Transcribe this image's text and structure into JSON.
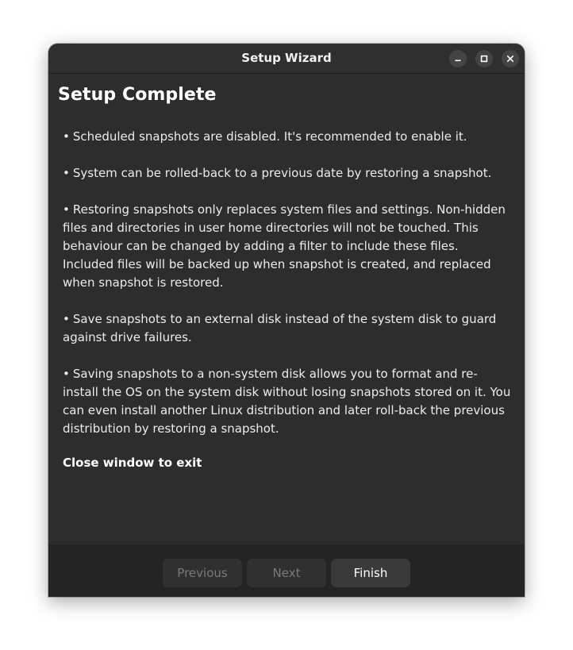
{
  "window": {
    "title": "Setup Wizard"
  },
  "page": {
    "heading": "Setup Complete",
    "bullet_glyph": "•",
    "notes": [
      "Scheduled snapshots are disabled. It's recommended to enable it.",
      "System can be rolled-back to a previous date by restoring a snapshot.",
      "Restoring snapshots only replaces system files and settings. Non-hidden files and directories in user home directories will not be touched. This behaviour can be changed by adding a filter to include these files. Included files will be backed up when snapshot is created, and replaced when snapshot is restored.",
      "Save snapshots to an external disk instead of the system disk to guard against drive failures.",
      "Saving snapshots to a non-system disk allows you to format and re-install the OS on the system disk without losing snapshots stored on it. You can even install another Linux distribution and later roll-back the previous distribution by restoring a snapshot."
    ],
    "exit_text": "Close window to exit"
  },
  "footer": {
    "previous_label": "Previous",
    "next_label": "Next",
    "finish_label": "Finish"
  },
  "icons": {
    "minimize": "minimize-icon",
    "maximize": "maximize-icon",
    "close": "close-icon"
  },
  "colors": {
    "window_bg": "#2d2d2d",
    "footer_bg": "#242424",
    "button_bg": "#303030",
    "disabled_text": "#7a7a7a",
    "text": "#ffffff"
  }
}
